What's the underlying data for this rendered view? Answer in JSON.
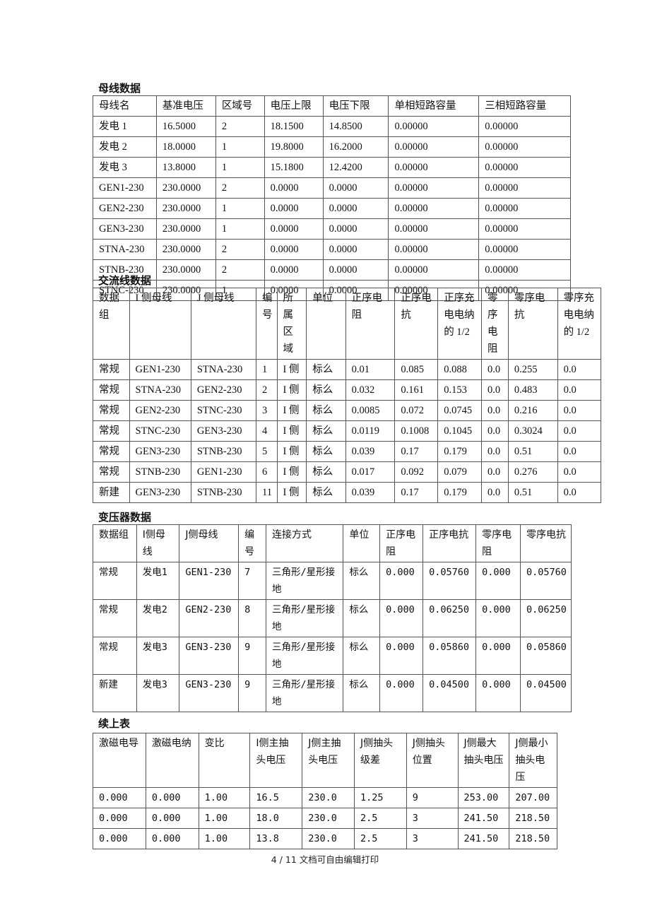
{
  "bus": {
    "title": "母线数据",
    "headers": [
      "母线名",
      "基准电压",
      "区域号",
      "电压上限",
      "电压下限",
      "单相短路容量",
      "三相短路容量"
    ],
    "rows": [
      [
        "发电 1",
        "16.5000",
        "2",
        "18.1500",
        "14.8500",
        "0.00000",
        "0.00000"
      ],
      [
        "发电 2",
        "18.0000",
        "1",
        "19.8000",
        "16.2000",
        "0.00000",
        "0.00000"
      ],
      [
        "发电 3",
        "13.8000",
        "1",
        "15.1800",
        "12.4200",
        "0.00000",
        "0.00000"
      ],
      [
        "GEN1-230",
        "230.0000",
        "2",
        "0.0000",
        "0.0000",
        "0.00000",
        "0.00000"
      ],
      [
        "GEN2-230",
        "230.0000",
        "1",
        "0.0000",
        "0.0000",
        "0.00000",
        "0.00000"
      ],
      [
        "GEN3-230",
        "230.0000",
        "1",
        "0.0000",
        "0.0000",
        "0.00000",
        "0.00000"
      ],
      [
        "STNA-230",
        "230.0000",
        "2",
        "0.0000",
        "0.0000",
        "0.00000",
        "0.00000"
      ],
      [
        "STNB-230",
        "230.0000",
        "2",
        "0.0000",
        "0.0000",
        "0.00000",
        "0.00000"
      ],
      [
        "STNC-230",
        "230.0000",
        "1",
        "0.0000",
        "0.0000",
        "0.00000",
        "0.00000"
      ]
    ]
  },
  "acline": {
    "title": "交流线数据",
    "headers": [
      "数据组",
      "I 侧母线",
      "J 侧母线",
      "编号",
      "所属区域",
      "单位",
      "正序电阻",
      "正序电抗",
      "正序充电电纳的 1/2",
      "零序电阻",
      "零序电抗",
      "零序充电电纳的 1/2"
    ],
    "rows": [
      [
        "常规",
        "GEN1-230",
        "STNA-230",
        "1",
        "I 侧",
        "标么",
        "0.01",
        "0.085",
        "0.088",
        "0.0",
        "0.255",
        "0.0"
      ],
      [
        "常规",
        "STNA-230",
        "GEN2-230",
        "2",
        "I 侧",
        "标么",
        "0.032",
        "0.161",
        "0.153",
        "0.0",
        "0.483",
        "0.0"
      ],
      [
        "常规",
        "GEN2-230",
        "STNC-230",
        "3",
        "I 侧",
        "标么",
        "0.0085",
        "0.072",
        "0.0745",
        "0.0",
        "0.216",
        "0.0"
      ],
      [
        "常规",
        "STNC-230",
        "GEN3-230",
        "4",
        "I 侧",
        "标么",
        "0.0119",
        "0.1008",
        "0.1045",
        "0.0",
        "0.3024",
        "0.0"
      ],
      [
        "常规",
        "GEN3-230",
        "STNB-230",
        "5",
        "I 侧",
        "标么",
        "0.039",
        "0.17",
        "0.179",
        "0.0",
        "0.51",
        "0.0"
      ],
      [
        "常规",
        "STNB-230",
        "GEN1-230",
        "6",
        "I 侧",
        "标么",
        "0.017",
        "0.092",
        "0.079",
        "0.0",
        "0.276",
        "0.0"
      ],
      [
        "新建",
        "GEN3-230",
        "STNB-230",
        "11",
        "I 侧",
        "标么",
        "0.039",
        "0.17",
        "0.179",
        "0.0",
        "0.51",
        "0.0"
      ]
    ]
  },
  "transformer": {
    "title": "变压器数据",
    "headers": [
      "数据组",
      "I侧母线",
      "J侧母线",
      "编号",
      "连接方式",
      "单位",
      "正序电阻",
      "正序电抗",
      "零序电阻",
      "零序电抗"
    ],
    "rows": [
      [
        "常规",
        "发电1",
        "GEN1-230",
        "7",
        "三角形/星形接地",
        "标么",
        "0.000",
        "0.05760",
        "0.000",
        "0.05760"
      ],
      [
        "常规",
        "发电2",
        "GEN2-230",
        "8",
        "三角形/星形接地",
        "标么",
        "0.000",
        "0.06250",
        "0.000",
        "0.06250"
      ],
      [
        "常规",
        "发电3",
        "GEN3-230",
        "9",
        "三角形/星形接地",
        "标么",
        "0.000",
        "0.05860",
        "0.000",
        "0.05860"
      ],
      [
        "新建",
        "发电3",
        "GEN3-230",
        "9",
        "三角形/星形接地",
        "标么",
        "0.000",
        "0.04500",
        "0.000",
        "0.04500"
      ]
    ]
  },
  "cont": {
    "title": "续上表",
    "headers": [
      "激磁电导",
      "激磁电纳",
      "变比",
      "I侧主抽头电压",
      "J侧主抽头电压",
      "J侧抽头级差",
      "J侧抽头位置",
      "J侧最大抽头电压",
      "J侧最小抽头电压"
    ],
    "rows": [
      [
        "0.000",
        "0.000",
        "1.00",
        "16.5",
        "230.0",
        "1.25",
        "9",
        "253.00",
        "207.00"
      ],
      [
        "0.000",
        "0.000",
        "1.00",
        "18.0",
        "230.0",
        "2.5",
        "3",
        "241.50",
        "218.50"
      ],
      [
        "0.000",
        "0.000",
        "1.00",
        "13.8",
        "230.0",
        "2.5",
        "3",
        "241.50",
        "218.50"
      ]
    ]
  },
  "footer": {
    "text": "4 / 11 文档可自由编辑打印"
  }
}
